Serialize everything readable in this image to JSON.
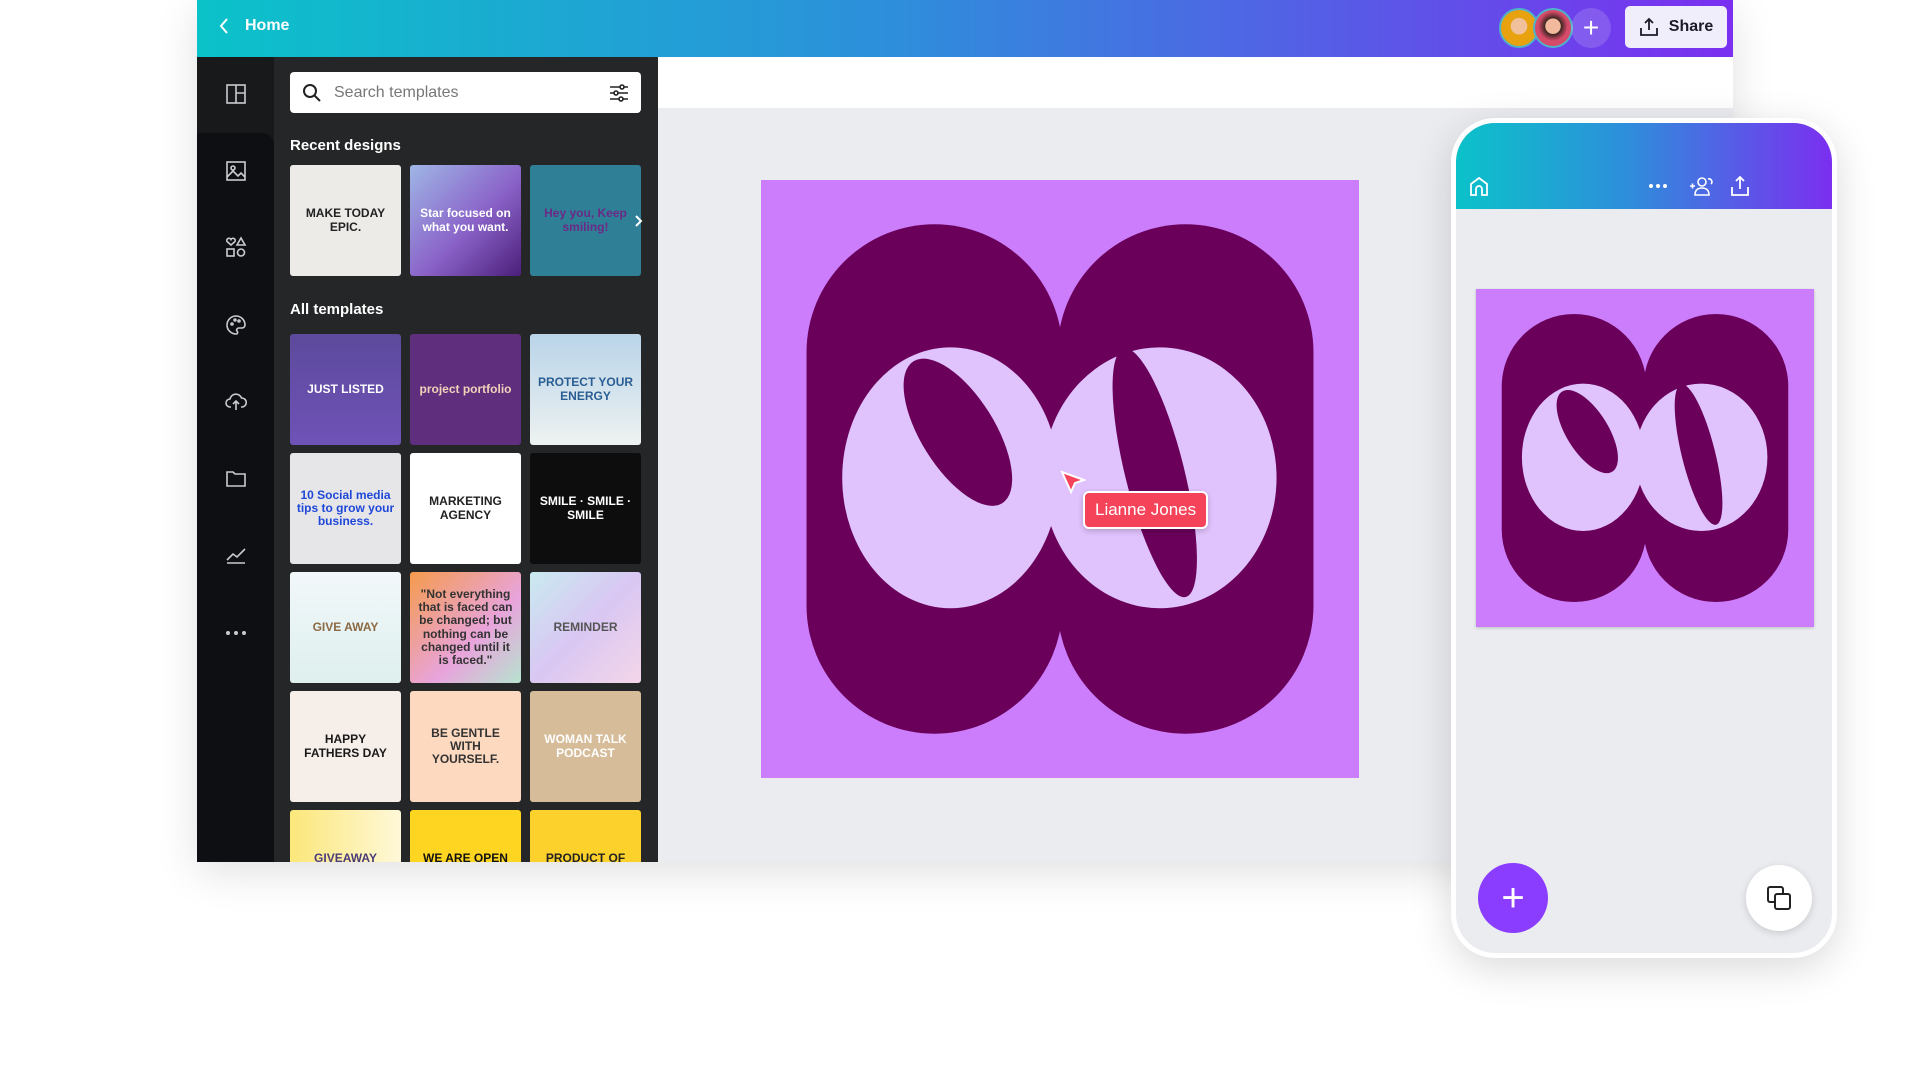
{
  "header": {
    "back_label": "Home",
    "share_label": "Share"
  },
  "search": {
    "placeholder": "Search templates"
  },
  "sections": {
    "recent": "Recent designs",
    "all": "All templates"
  },
  "recent_designs": [
    {
      "text": "MAKE TODAY EPIC.",
      "bg": "#ecebe8",
      "fg": "#222"
    },
    {
      "text": "Star focused on what you want.",
      "bg": "linear-gradient(135deg,#9fb6e6,#8a62c8 55%,#4b1f7a)",
      "fg": "#fff"
    },
    {
      "text": "Hey you, Keep smiling!",
      "bg": "#2f7f97",
      "fg": "#6b2a86"
    }
  ],
  "templates": [
    {
      "text": "JUST LISTED",
      "bg": "linear-gradient(#5c4a9c,#6f52b7)",
      "fg": "#fff"
    },
    {
      "text": "project portfolio",
      "bg": "#5f2f7e",
      "fg": "#f3d2b9"
    },
    {
      "text": "PROTECT YOUR ENERGY",
      "bg": "linear-gradient(#b9d4e9,#eef2f1)",
      "fg": "#2a5e93"
    },
    {
      "text": "10 Social media tips to grow your business.",
      "bg": "#e6e6e9",
      "fg": "#1f47d8"
    },
    {
      "text": "MARKETING AGENCY",
      "bg": "#fff",
      "fg": "#222"
    },
    {
      "text": "SMILE · SMILE · SMILE",
      "bg": "#0d0d0d",
      "fg": "#fff"
    },
    {
      "text": "GIVE AWAY",
      "bg": "linear-gradient(#f2f7fa,#def0ee)",
      "fg": "#8a6a44"
    },
    {
      "text": "\"Not everything that is faced can be changed; but nothing can be changed until it is faced.\"",
      "bg": "linear-gradient(135deg,#f59b4c,#e8a4dc 60%,#b7e3cf)",
      "fg": "#333"
    },
    {
      "text": "REMINDER",
      "bg": "linear-gradient(135deg,#c9eaf0,#d9c7f3 50%,#f4d6e9)",
      "fg": "#555"
    },
    {
      "text": "HAPPY FATHERS DAY",
      "bg": "#f6eee8",
      "fg": "#1a1a1a"
    },
    {
      "text": "BE GENTLE WITH YOURSELF.",
      "bg": "#fcd9bf",
      "fg": "#333"
    },
    {
      "text": "WOMAN TALK PODCAST",
      "bg": "#d6bc98",
      "fg": "#fff"
    },
    {
      "text": "GIVEAWAY GIVEAWAY",
      "bg": "linear-gradient(90deg,#fbe77a,#fff8d8)",
      "fg": "#4a3b7a"
    },
    {
      "text": "WE ARE OPEN TODAY",
      "bg": "#fed521",
      "fg": "#111"
    },
    {
      "text": "PRODUCT OF THE MONTH",
      "bg": "#fdd12b",
      "fg": "#222"
    }
  ],
  "collaborator": {
    "name": "Lianne Jones",
    "color": "#f5435a"
  },
  "colors": {
    "design_bg": "#cc7dfb",
    "design_dark": "#6a005a",
    "design_light": "#e0c2fc",
    "fab": "#8b3dff"
  },
  "rail_icons": [
    "layout-icon",
    "image-icon",
    "elements-icon",
    "palette-icon",
    "upload-icon",
    "folder-icon",
    "chart-icon",
    "more-icon"
  ]
}
